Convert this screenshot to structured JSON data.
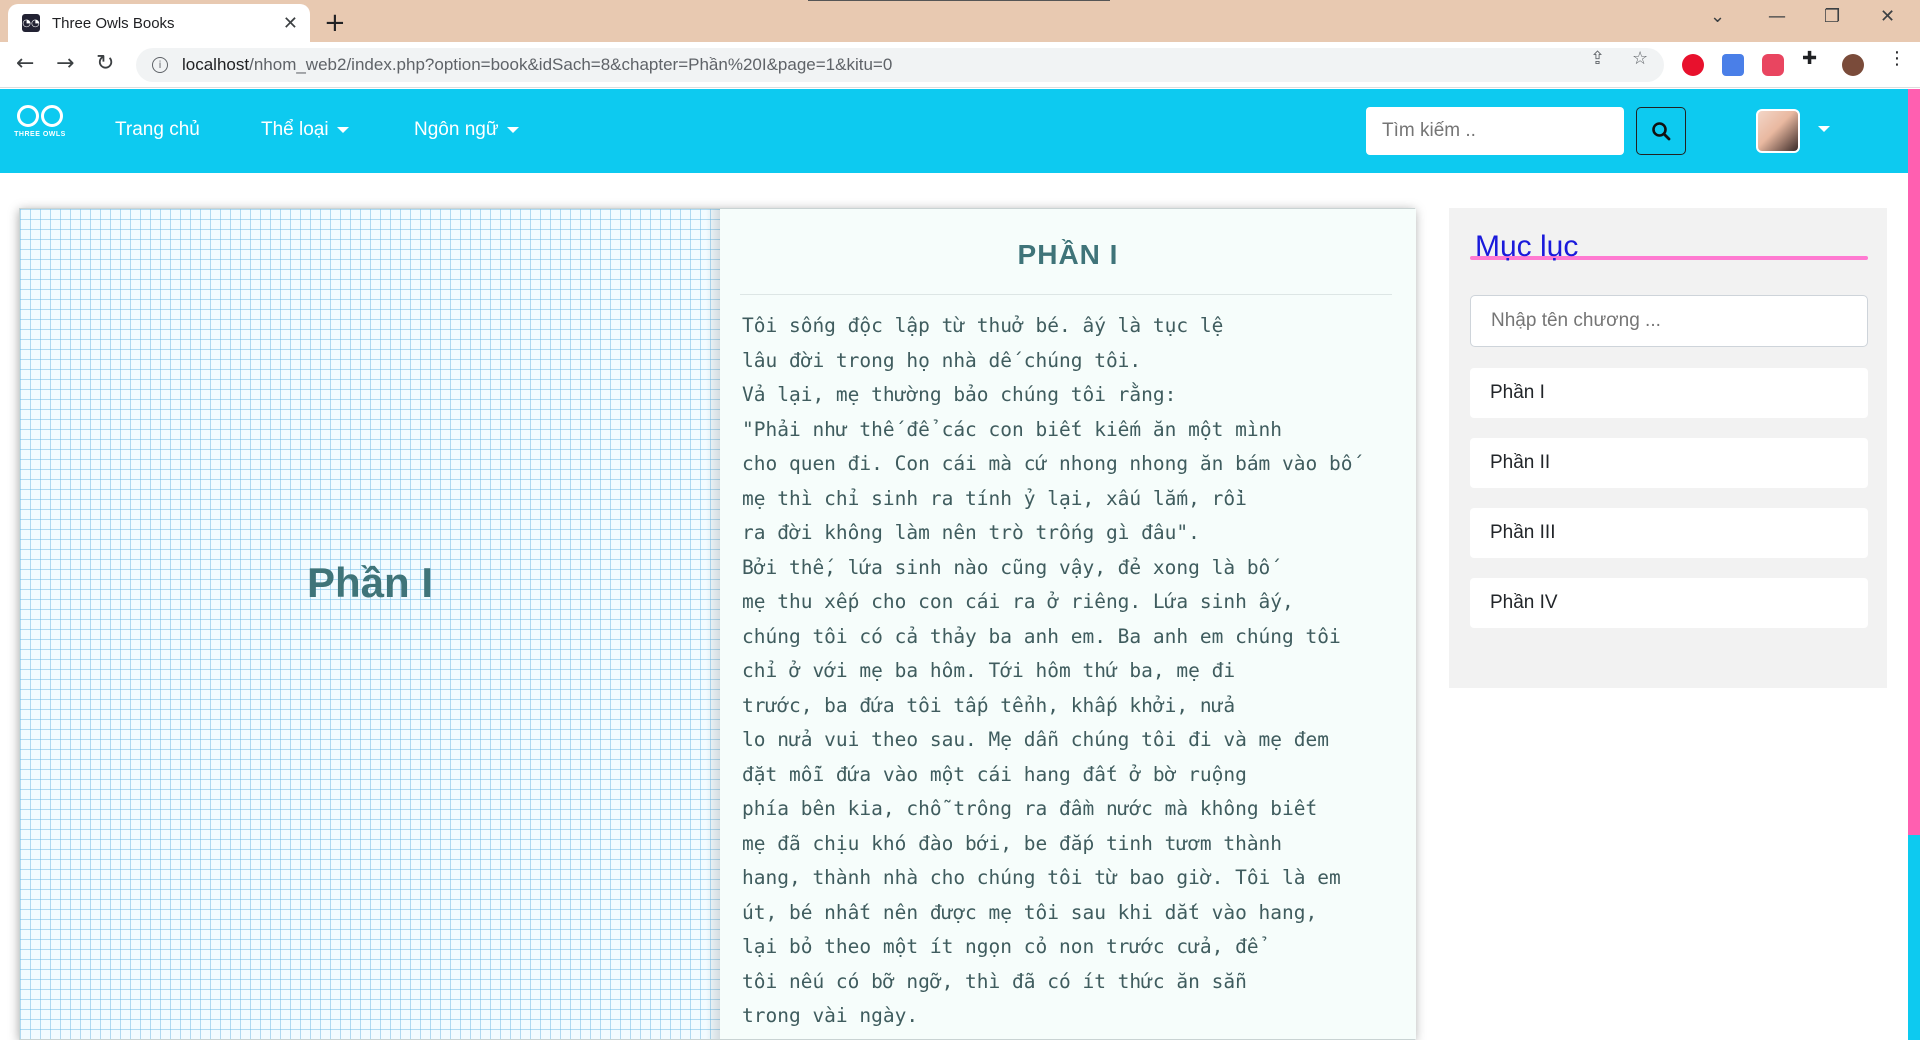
{
  "browser": {
    "tab_title": "Three Owls Books",
    "url_host": "localhost",
    "url_path": "/nhom_web2/index.php?option=book&idSach=8&chapter=Phần%20I&page=1&kitu=0"
  },
  "site": {
    "brand": "THREE OWLS",
    "nav": {
      "home": "Trang chủ",
      "category": "Thể loại",
      "language": "Ngôn ngữ"
    },
    "search_placeholder": "Tìm kiếm .."
  },
  "book": {
    "left_title": "Phần I",
    "chapter_heading": "PHẦN I",
    "lines": [
      "Tôi sống độc lập từ thuở bé. ấy là tục lệ",
      "lâu đời trong họ nhà dế chúng tôi.",
      "Vả lại, mẹ thường bảo chúng tôi rằng:",
      "\"Phải như thế để các con biết kiếm ăn một mình",
      "cho quen đi. Con cái mà cứ nhong nhong ăn bám vào bố",
      "mẹ thì chỉ sinh ra tính ỷ lại, xấu lắm, rồi",
      "ra đời không làm nên trò trống gì đâu\".",
      "Bởi thế, lứa sinh nào cũng vậy, đẻ xong là bố",
      "mẹ thu xếp cho con cái ra ở riêng. Lứa sinh ấy,",
      "chúng tôi có cả thảy ba anh em. Ba anh em chúng tôi",
      "chỉ ở với mẹ ba hôm. Tới hôm thứ ba, mẹ đi",
      "trước, ba đứa tôi tấp tểnh, khấp khởi, nửa",
      "lo nửa vui theo sau. Mẹ dẫn chúng tôi đi và mẹ đem",
      "đặt mỗi đứa vào một cái hang đất ở bờ ruộng",
      "phía bên kia, chỗ trông ra đầm nước mà không biết",
      "mẹ đã chịu khó đào bới, be đắp tinh tươm thành",
      "hang, thành nhà cho chúng tôi từ bao giờ. Tôi là em",
      "út, bé nhất nên được mẹ tôi sau khi dắt vào hang,",
      "lại bỏ theo một ít ngọn cỏ non trước cửa, để",
      "tôi nếu có bỡ ngỡ, thì đã có ít thức ăn sẵn",
      "trong vài ngày."
    ]
  },
  "toc": {
    "title": "Mục lục",
    "search_placeholder": "Nhập tên chương ...",
    "items": [
      "Phần I",
      "Phần II",
      "Phần III",
      "Phần IV"
    ]
  },
  "colors": {
    "navbar": "#0dcaf0",
    "toc_title": "#1a1adb",
    "toc_underline": "#ff7ad1",
    "chapter_text": "#3f7479"
  }
}
